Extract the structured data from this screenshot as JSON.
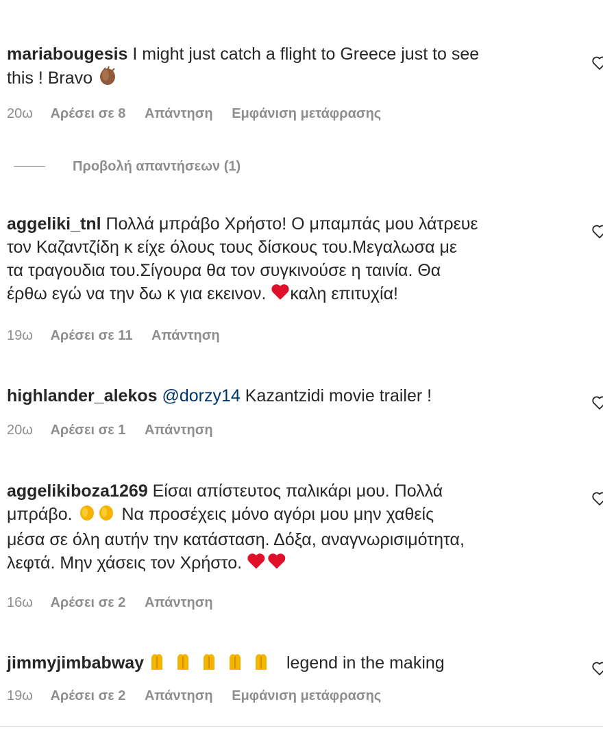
{
  "comments": [
    {
      "username": "mariabougesis",
      "text_line1": "I might just catch a flight to Greece just to see",
      "text_line2": "this ! Bravo",
      "time": "20ω",
      "likes": "Αρέσει σε 8",
      "reply": "Απάντηση",
      "translate": "Εμφάνιση μετάφρασης",
      "view_replies": "Προβολή απαντήσεων (1)"
    },
    {
      "username": "aggeliki_tnl",
      "text_line1": "Πολλά μπράβο Χρήστο! Ο μπαμπάς μου λάτρευε",
      "text_line2": "τον Καζαντζίδη κ είχε όλους τους δίσκους του.Μεγαλωσα με",
      "text_line3": "τα τραγουδια του.Σίγουρα θα τον συγκινούσε η ταινία. Θα",
      "text_line4a": "έρθω εγώ να την δω κ για εκεινον.",
      "text_line4b": "καλη επιτυχία!",
      "time": "19ω",
      "likes": "Αρέσει σε 11",
      "reply": "Απάντηση"
    },
    {
      "username": "highlander_alekos",
      "mention": "@dorzy14",
      "text": "Kazantzidi movie trailer !",
      "time": "20ω",
      "likes": "Αρέσει σε 1",
      "reply": "Απάντηση"
    },
    {
      "username": "aggelikiboza1269",
      "text_line1": "Είσαι απίστευτος παλικάρι μου. Πολλά",
      "text_line2a": "μπράβο.",
      "text_line2b": "Να προσέχεις μόνο αγόρι μου μην χαθείς",
      "text_line3": "μέσα σε όλη αυτήν την κατάσταση. Δόξα, αναγνωρισιμότητα,",
      "text_line4": "λεφτά. Μην χάσεις τον Χρήστο.",
      "time": "16ω",
      "likes": "Αρέσει σε 2",
      "reply": "Απάντηση"
    },
    {
      "username": "jimmyjimbabway",
      "text": "legend in the making",
      "time": "19ω",
      "likes": "Αρέσει σε 2",
      "reply": "Απάντηση",
      "translate": "Εμφάνιση μετάφρασης"
    }
  ],
  "icons": {
    "heart": "heart-outline-icon",
    "clap": "clapping-hands-emoji",
    "red_heart": "red-heart-emoji",
    "raised_hands": "raising-hands-emoji"
  },
  "colors": {
    "text": "#262626",
    "meta": "#8e8e8e",
    "mention": "#00376b",
    "heart_red": "#e0102a",
    "clap": "#f4b400"
  }
}
